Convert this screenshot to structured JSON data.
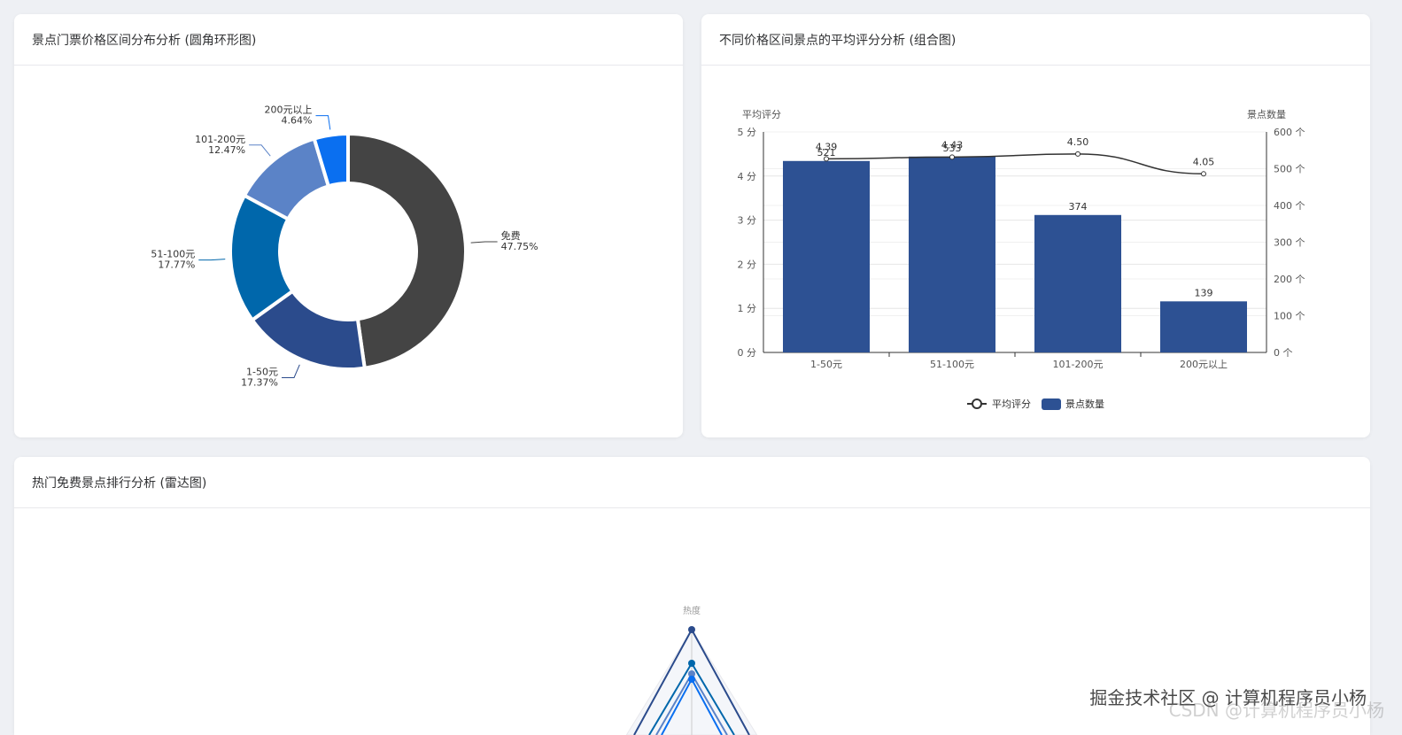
{
  "cards": {
    "donut_title": "景点门票价格区间分布分析 (圆角环形图)",
    "combo_title": "不同价格区间景点的平均评分分析 (组合图)",
    "radar_title": "热门免费景点排行分析 (雷达图)"
  },
  "chart_data": [
    {
      "type": "pie",
      "variant": "donut",
      "title": "景点门票价格区间分布分析 (圆角环形图)",
      "slices": [
        {
          "name": "免费",
          "percent": 47.75,
          "label": "47.75%",
          "color": "#444444"
        },
        {
          "name": "1-50元",
          "percent": 17.37,
          "label": "17.37%",
          "color": "#2b4b8c"
        },
        {
          "name": "51-100元",
          "percent": 17.77,
          "label": "17.77%",
          "color": "#0067ab"
        },
        {
          "name": "101-200元",
          "percent": 12.47,
          "label": "12.47%",
          "color": "#5b83c7"
        },
        {
          "name": "200元以上",
          "percent": 4.64,
          "label": "4.64%",
          "color": "#0a6ff0"
        }
      ]
    },
    {
      "type": "bar+line",
      "title": "不同价格区间景点的平均评分分析 (组合图)",
      "categories": [
        "1-50元",
        "51-100元",
        "101-200元",
        "200元以上"
      ],
      "y_left": {
        "label": "平均评分",
        "range": [
          0,
          5
        ],
        "ticks": [
          "0 分",
          "1 分",
          "2 分",
          "3 分",
          "4 分",
          "5 分"
        ]
      },
      "y_right": {
        "label": "景点数量",
        "range": [
          0,
          600
        ],
        "ticks": [
          "0 个",
          "100 个",
          "200 个",
          "300 个",
          "400 个",
          "500 个",
          "600 个"
        ]
      },
      "series": [
        {
          "name": "景点数量",
          "type": "bar",
          "axis": "right",
          "values": [
            521,
            533,
            374,
            139
          ],
          "labels": [
            "521",
            "533",
            "374",
            "139"
          ],
          "color": "#2d5193"
        },
        {
          "name": "平均评分",
          "type": "line",
          "axis": "left",
          "values": [
            4.39,
            4.43,
            4.5,
            4.05
          ],
          "labels": [
            "4.39",
            "4.43",
            "4.50",
            "4.05"
          ],
          "color": "#333333"
        }
      ],
      "legend": [
        "平均评分",
        "景点数量"
      ],
      "legend_position": "bottom"
    },
    {
      "type": "radar",
      "title": "热门免费景点排行分析 (雷达图)",
      "indicator_visible": "热度"
    }
  ],
  "watermark": {
    "line1": "掘金技术社区 @ 计算机程序员小杨",
    "line2": "CSDN @计算机程序员小杨"
  }
}
